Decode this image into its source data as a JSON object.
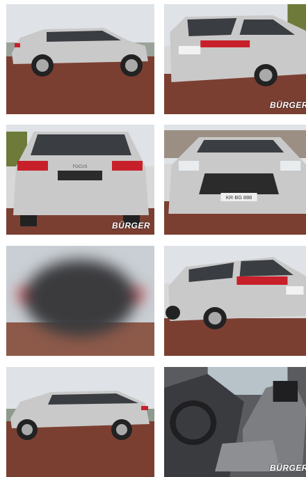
{
  "gallery": {
    "watermark": "BÜRGER",
    "plate_front": "KR·BG 888",
    "badge_text": "FOCUS",
    "colors": {
      "car_silver": "#c9c9c9",
      "taillight": "#c8202a",
      "pavement": "#7b3f32",
      "sky": "#dfe2e6"
    },
    "photos": [
      {
        "id": "side-left",
        "has_watermark": false
      },
      {
        "id": "rear-three-quarter",
        "has_watermark": true
      },
      {
        "id": "rear",
        "has_watermark": true
      },
      {
        "id": "front",
        "has_watermark": false
      },
      {
        "id": "blurred",
        "has_watermark": false
      },
      {
        "id": "rear-three-quarter-2",
        "has_watermark": false
      },
      {
        "id": "side-left-2",
        "has_watermark": false
      },
      {
        "id": "interior",
        "has_watermark": true
      }
    ]
  }
}
